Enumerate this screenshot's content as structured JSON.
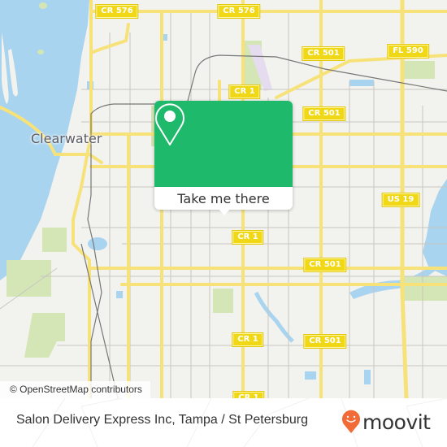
{
  "map": {
    "city_label": "Clearwater",
    "road_labels": [
      {
        "id": "cr576-west",
        "text": "CR 576"
      },
      {
        "id": "cr576-east",
        "text": "CR 576"
      },
      {
        "id": "cr501-north",
        "text": "CR 501"
      },
      {
        "id": "fl590",
        "text": "FL 590"
      },
      {
        "id": "cr1-north",
        "text": "CR 1"
      },
      {
        "id": "cr501-mid",
        "text": "CR 501"
      },
      {
        "id": "cr1-mid",
        "text": "CR 1"
      },
      {
        "id": "us19",
        "text": "US 19"
      },
      {
        "id": "cr501-east",
        "text": "CR 501"
      },
      {
        "id": "cr1-south",
        "text": "CR 1"
      },
      {
        "id": "cr501-south",
        "text": "CR 501"
      },
      {
        "id": "cr1-bottom",
        "text": "CR 1"
      },
      {
        "id": "partial-right",
        "text": ""
      }
    ],
    "attribution": "© OpenStreetMap contributors",
    "colors": {
      "land": "#f2f2ee",
      "water": "#a9d4ef",
      "park": "#d4e6b5",
      "major_road": "#f7e27a",
      "minor_road": "#c8c6c0",
      "rail": "#777777",
      "airport": "#e6dcf0"
    }
  },
  "popup": {
    "button_label": "Take me there",
    "accent_color": "#1fb96b",
    "icon": "location-pin-icon"
  },
  "footer": {
    "place_text": "Salon Delivery Express Inc, Tampa / St Petersburg",
    "logo_text": "moovit",
    "logo_color": "#f26a35"
  }
}
